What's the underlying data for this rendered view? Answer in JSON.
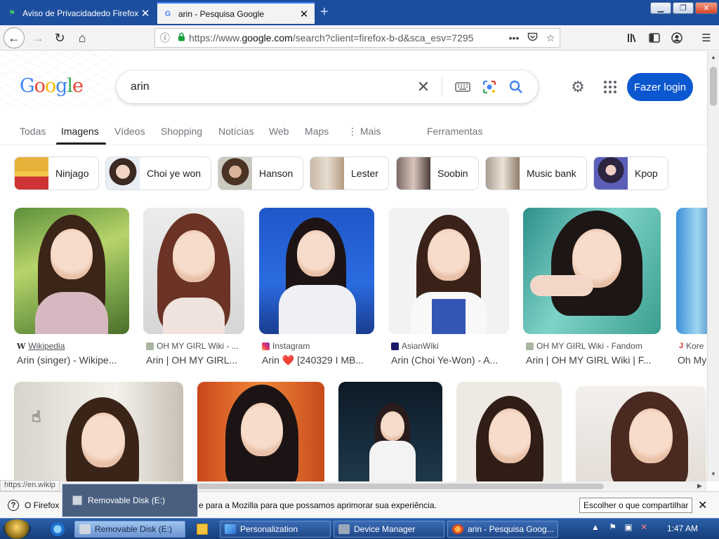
{
  "browser": {
    "tabs": [
      {
        "title": "Aviso de Privacidadedo Firefox",
        "icon": "firefox-notice-icon"
      },
      {
        "title": "arin - Pesquisa Google",
        "icon": "google-g-icon"
      }
    ],
    "url_prefix": "https://www.",
    "url_domain": "google.com",
    "url_rest": "/search?client=firefox-b-d&sca_esv=7295",
    "url_actions_label": "•••"
  },
  "google": {
    "logo": [
      "G",
      "o",
      "o",
      "g",
      "l",
      "e"
    ],
    "query": "arin",
    "login_label": "Fazer login",
    "tabs": [
      {
        "label": "Todas",
        "selected": false
      },
      {
        "label": "Imagens",
        "selected": true
      },
      {
        "label": "Vídeos",
        "selected": false
      },
      {
        "label": "Shopping",
        "selected": false
      },
      {
        "label": "Notícias",
        "selected": false
      },
      {
        "label": "Web",
        "selected": false
      },
      {
        "label": "Maps",
        "selected": false
      },
      {
        "label": "⋮ Mais",
        "selected": false
      }
    ],
    "tools_label": "Ferramentas",
    "chips": [
      "Ninjago",
      "Choi ye won",
      "Hanson",
      "Lester",
      "Soobin",
      "Music bank",
      "Kpop"
    ],
    "results_row1": [
      {
        "source": "Wikipedia",
        "caption": "Arin (singer) - Wikipe...",
        "source_icon_color": "#5f6368"
      },
      {
        "source": "OH MY GIRL Wiki - ...",
        "caption": "Arin | OH MY GIRL...",
        "source_icon_color": "#a8b6a0"
      },
      {
        "source": "Instagram",
        "caption": "Arin ❤️ [240329 I MB...",
        "source_icon_color": "#e1306c"
      },
      {
        "source": "AsianWiki",
        "caption": "Arin (Choi Ye-Won) - A...",
        "source_icon_color": "#1a1a66"
      },
      {
        "source": "OH MY GIRL Wiki - Fandom",
        "caption": "Arin | OH MY GIRL Wiki | F...",
        "source_icon_color": "#a8b6a0"
      },
      {
        "source": "Kore",
        "caption": "Oh My",
        "source_icon_color": "#d93025"
      }
    ]
  },
  "status": {
    "hover_url": "https://en.wikip"
  },
  "notice": {
    "text_left": "O Firefox",
    "text_right": "e para a Mozilla para que possamos aprimorar sua experiência.",
    "button_label": "Escolher o que compartilhar",
    "close_label": "✕"
  },
  "tooltip": {
    "label": "Removable Disk (E:)"
  },
  "taskbar": {
    "items": [
      {
        "label": "Removable Disk (E:)",
        "active": true
      },
      {
        "label": "Personalization",
        "active": false
      },
      {
        "label": "Device Manager",
        "active": false
      },
      {
        "label": "arin - Pesquisa Goog...",
        "active": false
      }
    ],
    "clock": "1:47 AM"
  }
}
